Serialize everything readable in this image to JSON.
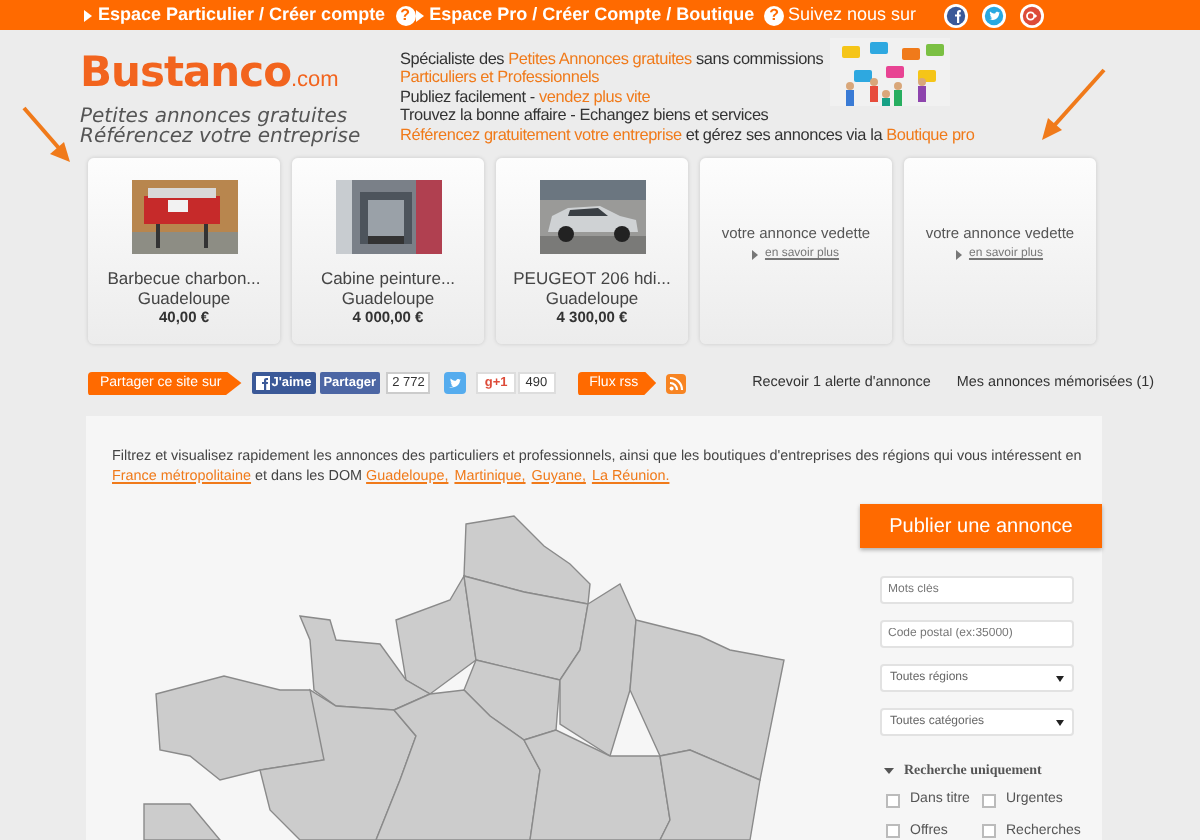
{
  "top_bar": {
    "links": [
      {
        "label": "Espace Particulier / Créer compte",
        "help": "?"
      },
      {
        "label": "Espace Pro / Créer Compte / Boutique",
        "help": "?"
      }
    ],
    "follow_label": "Suivez nous sur"
  },
  "header": {
    "logo": {
      "name": "Bustanco",
      "suffix": ".com"
    },
    "taglines": [
      "Petites annonces gratuites",
      "Référencez votre entreprise"
    ],
    "lines": [
      [
        {
          "text": "Spécialiste des ",
          "highlight": false
        },
        {
          "text": "Petites Annonces gratuites",
          "highlight": true
        },
        {
          "text": " sans commissions",
          "highlight": false
        }
      ],
      [
        {
          "text": "Particuliers et Professionnels",
          "highlight": true
        }
      ],
      [
        {
          "text": "Publiez facilement - ",
          "highlight": false
        },
        {
          "text": "vendez plus vite",
          "highlight": true
        }
      ],
      [
        {
          "text": "Trouvez la bonne affaire - Echangez biens et services",
          "highlight": false
        }
      ],
      [
        {
          "text": "Référencez gratuitement votre entreprise",
          "highlight": true
        },
        {
          "text": " et gérez ses annonces via la ",
          "highlight": false
        },
        {
          "text": "Boutique pro",
          "highlight": true
        }
      ]
    ]
  },
  "cards": [
    {
      "kind": "listing",
      "title": "Barbecue charbon...",
      "location": "Guadeloupe",
      "price": "40,00 €"
    },
    {
      "kind": "listing",
      "title": "Cabine peinture...",
      "location": "Guadeloupe",
      "price": "4 000,00 €"
    },
    {
      "kind": "listing",
      "title": "PEUGEOT 206 hdi...",
      "location": "Guadeloupe",
      "price": "4 300,00 €"
    },
    {
      "kind": "featured",
      "text": "votre annonce vedette",
      "link": "en savoir plus"
    },
    {
      "kind": "featured",
      "text": "votre annonce vedette",
      "link": "en savoir plus"
    }
  ],
  "share_bar": {
    "share_label": "Partager ce site sur",
    "like": "J'aime",
    "share": "Partager",
    "share_count": "2 772",
    "plus_one": "g+1",
    "plus_count": "490",
    "rss_label": "Flux rss",
    "alert_link": "Recevoir 1 alerte d'annonce",
    "saved_link": "Mes annonces mémorisées (1)"
  },
  "intro": [
    {
      "text": "Filtrez et visualisez rapidement les annonces des particuliers et professionnels, ainsi que les boutiques d'entreprises des régions qui vous intéressent en ",
      "link": false
    },
    {
      "text": "France métropolitaine",
      "link": true
    },
    {
      "text": " et dans les DOM ",
      "link": false
    },
    {
      "text": "Guadeloupe,",
      "link": true
    },
    {
      "text": "Martinique,",
      "link": true
    },
    {
      "text": "Guyane,",
      "link": true
    },
    {
      "text": "La Réunion.",
      "link": true
    }
  ],
  "search": {
    "publish_button": "Publier une annonce",
    "fields": [
      {
        "kind": "input",
        "placeholder": "Mots clés"
      },
      {
        "kind": "input",
        "placeholder": "Code postal (ex:35000)"
      },
      {
        "kind": "select",
        "value": "Toutes régions"
      },
      {
        "kind": "select",
        "value": "Toutes catégories"
      }
    ],
    "filter_title": "Recherche uniquement",
    "filter_expanded": true,
    "filters": [
      {
        "label": "Dans titre",
        "checked": false
      },
      {
        "label": "Urgentes",
        "checked": false
      },
      {
        "label": "Offres",
        "checked": false
      },
      {
        "label": "Recherches",
        "checked": false
      }
    ]
  }
}
